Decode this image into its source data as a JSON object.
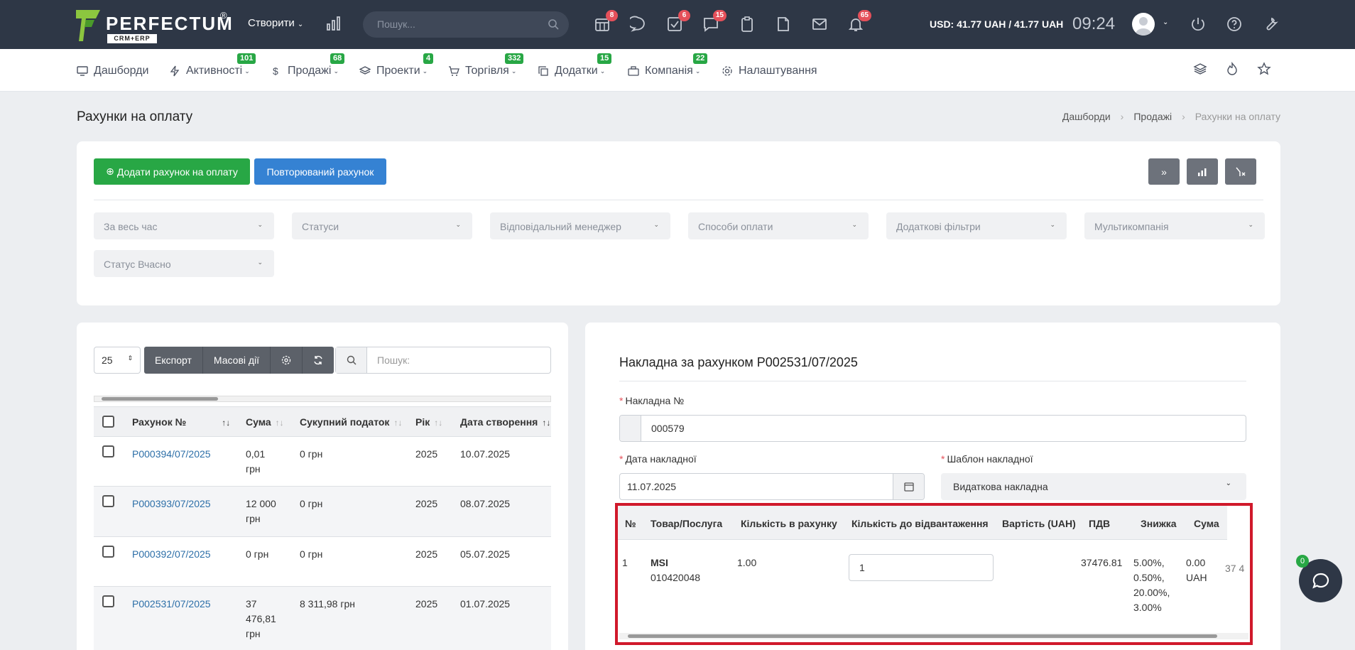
{
  "app": {
    "logo_text": "PERFECTUM",
    "logo_sub": "CRM+ERP",
    "logo_reg": "®",
    "create_menu": "Створити",
    "search_placeholder": "Пошук...",
    "currency": "USD: 41.77 UAH / 41.77 UAH",
    "clock": "09:24",
    "toolbar_badges": {
      "calendar": "8",
      "tasks": "6",
      "chats": "15",
      "notifications": "65"
    },
    "toolbar_icons": [
      "calendar-icon",
      "chat-icon",
      "tasks-icon",
      "messages-icon",
      "clipboard-icon",
      "file-icon",
      "mail-icon",
      "bell-icon"
    ]
  },
  "nav": {
    "items": [
      {
        "label": "Дашборди",
        "badge": "",
        "icon": "monitor-icon"
      },
      {
        "label": "Активності",
        "badge": "101",
        "icon": "bolt-icon"
      },
      {
        "label": "Продажі",
        "badge": "68",
        "icon": "dollar-icon"
      },
      {
        "label": "Проекти",
        "badge": "4",
        "icon": "layers-icon"
      },
      {
        "label": "Торгівля",
        "badge": "332",
        "icon": "cart-icon"
      },
      {
        "label": "Додатки",
        "badge": "15",
        "icon": "copy-icon"
      },
      {
        "label": "Компанія",
        "badge": "22",
        "icon": "briefcase-icon"
      },
      {
        "label": "Налаштування",
        "badge": "",
        "icon": "gear-icon"
      }
    ]
  },
  "page": {
    "title": "Рахунки на оплату",
    "breadcrumb": [
      "Дашборди",
      "Продажі",
      "Рахунки на оплату"
    ]
  },
  "filters": {
    "add_button": "Додати рахунок на оплату",
    "recurring_button": "Повторюваний рахунок",
    "selects": [
      "За весь час",
      "Статуси",
      "Відповідальний менеджер",
      "Способи оплати",
      "Додаткові фільтри",
      "Мультикомпанія",
      "Статус Вчасно"
    ]
  },
  "table": {
    "page_size": "25",
    "export_label": "Експорт",
    "bulk_label": "Масові дії",
    "search_placeholder": "Пошук:",
    "columns": [
      "Рахунок №",
      "Сума",
      "Сукупний податок",
      "Рік",
      "Дата створення"
    ],
    "rows": [
      {
        "number": "P000394/07/2025",
        "sum": "0,01 грн",
        "tax": "0 грн",
        "year": "2025",
        "date": "10.07.2025"
      },
      {
        "number": "P000393/07/2025",
        "sum": "12 000 грн",
        "tax": "0 грн",
        "year": "2025",
        "date": "08.07.2025"
      },
      {
        "number": "P000392/07/2025",
        "sum": "0 грн",
        "tax": "0 грн",
        "year": "2025",
        "date": "05.07.2025"
      },
      {
        "number": "P002531/07/2025",
        "sum": "37 476,81 грн",
        "tax": "8 311,98 грн",
        "year": "2025",
        "date": "01.07.2025"
      }
    ]
  },
  "invoice": {
    "title": "Накладна за рахунком P002531/07/2025",
    "number_label": "Накладна №",
    "number_value": "000579",
    "date_label": "Дата накладної",
    "date_value": "11.07.2025",
    "template_label": "Шаблон накладної",
    "template_value": "Видаткова накладна",
    "columns": [
      "№",
      "Товар/Послуга",
      "Кількість в рахунку",
      "Кількість до відвантаження",
      "Вартість (UAH)",
      "ПДВ",
      "Знижка",
      "Сума"
    ],
    "row": {
      "n": "1",
      "product_name": "MSI",
      "product_code": "010420048",
      "qty_invoice": "1.00",
      "qty_ship": "1",
      "price": "",
      "vat": "37476.81",
      "discount_lines": [
        "5.00%,",
        "0.50%,",
        "20.00%,",
        "3.00%"
      ],
      "discount_amount_lines": [
        "0.00",
        "UAH"
      ],
      "sum_partial": "37 4"
    }
  },
  "chat": {
    "badge": "0"
  }
}
